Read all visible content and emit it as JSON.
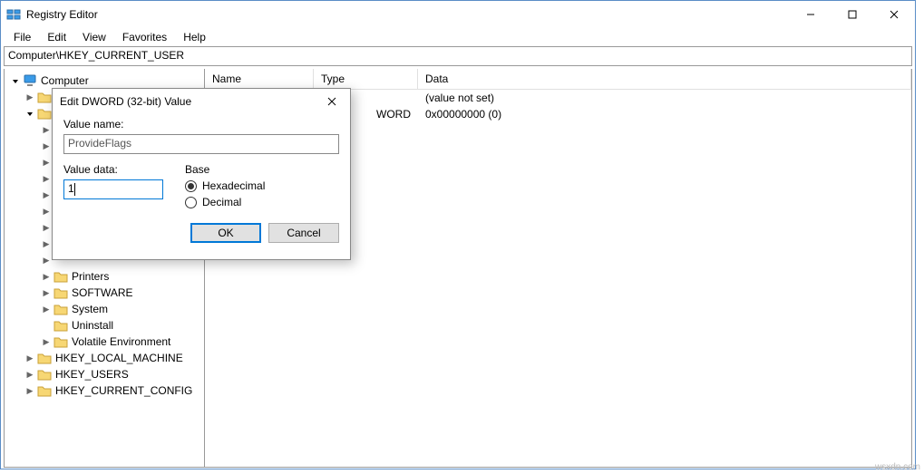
{
  "title": "Registry Editor",
  "menus": [
    "File",
    "Edit",
    "View",
    "Favorites",
    "Help"
  ],
  "address": "Computer\\HKEY_CURRENT_USER",
  "tree": {
    "root": "Computer",
    "items_lvl2": [
      "Printers",
      "SOFTWARE",
      "System",
      "Uninstall",
      "Volatile Environment"
    ],
    "items_lvl1": [
      "HKEY_LOCAL_MACHINE",
      "HKEY_USERS",
      "HKEY_CURRENT_CONFIG"
    ]
  },
  "list": {
    "headers": {
      "name": "Name",
      "type": "Type",
      "data": "Data"
    },
    "rows": [
      {
        "type": "",
        "data": "(value not set)"
      },
      {
        "type": "WORD",
        "data": "0x00000000 (0)"
      }
    ]
  },
  "dialog": {
    "title": "Edit DWORD (32-bit) Value",
    "value_name_label": "Value name:",
    "value_name": "ProvideFlags",
    "value_data_label": "Value data:",
    "value_data": "1",
    "base_label": "Base",
    "hex_label": "Hexadecimal",
    "dec_label": "Decimal",
    "ok": "OK",
    "cancel": "Cancel"
  },
  "watermark": "wsxdn.com"
}
